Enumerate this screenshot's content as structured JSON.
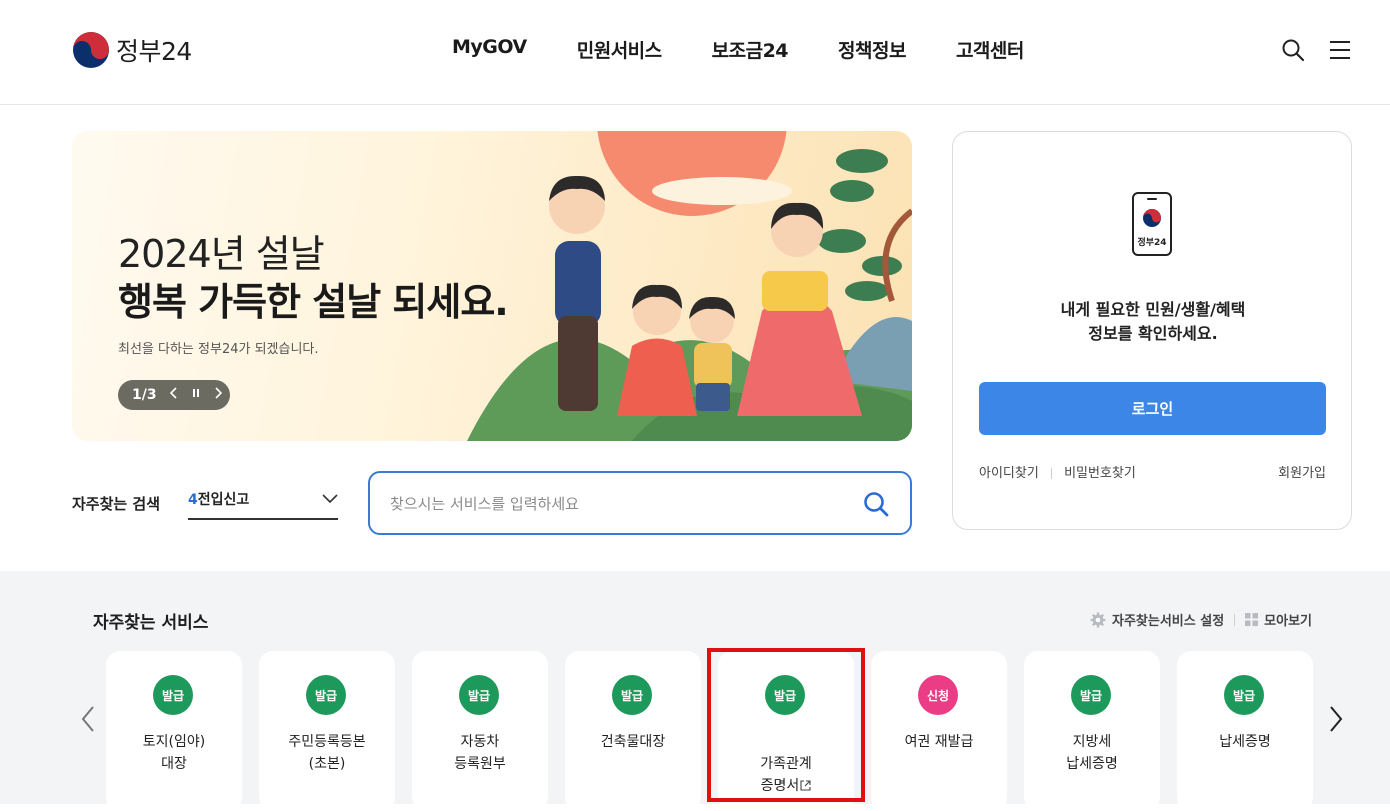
{
  "header": {
    "logo_text": "정부24",
    "nav": [
      "MyGOV",
      "민원서비스",
      "보조금24",
      "정책정보",
      "고객센터"
    ]
  },
  "banner": {
    "line1": "2024년 설날",
    "line2": "행복 가득한 설날 되세요.",
    "line3": "최선을 다하는 정부24가 되겠습니다.",
    "pager": "1/3"
  },
  "login": {
    "app_label": "정부24",
    "message_line1": "내게 필요한 민원/생활/혜택",
    "message_line2": "정보를 확인하세요.",
    "login_button": "로그인",
    "find_id": "아이디찾기",
    "find_pw": "비밀번호찾기",
    "signup": "회원가입"
  },
  "frequent_search": {
    "label": "자주찾는 검색",
    "selected_num": "4",
    "selected_text": "전입신고",
    "placeholder": "찾으시는 서비스를 입력하세요"
  },
  "services": {
    "title": "자주찾는 서비스",
    "settings_label": "자주찾는서비스 설정",
    "collect_label": "모아보기",
    "colors": {
      "issue": "#1d9a5b",
      "apply": "#ea3d86",
      "primary": "#3b86e6"
    },
    "items": [
      {
        "badge": "발급",
        "label": "토지(임야)\n대장",
        "badge_type": "issue"
      },
      {
        "badge": "발급",
        "label": "주민등록등본\n(초본)",
        "badge_type": "issue"
      },
      {
        "badge": "발급",
        "label": "자동차\n등록원부",
        "badge_type": "issue"
      },
      {
        "badge": "발급",
        "label": "건축물대장",
        "badge_type": "issue"
      },
      {
        "badge": "발급",
        "label": "가족관계\n증명서",
        "badge_type": "issue",
        "external": true
      },
      {
        "badge": "신청",
        "label": "여권 재발급",
        "badge_type": "apply"
      },
      {
        "badge": "발급",
        "label": "지방세\n납세증명",
        "badge_type": "issue"
      },
      {
        "badge": "발급",
        "label": "납세증명",
        "badge_type": "issue"
      }
    ]
  }
}
